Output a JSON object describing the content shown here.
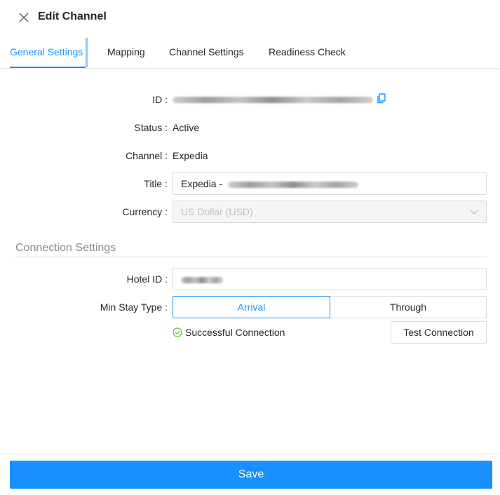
{
  "header": {
    "title": "Edit Channel",
    "close_icon": "close-icon"
  },
  "tabs": [
    {
      "label": "General Settings",
      "active": true
    },
    {
      "label": "Mapping",
      "active": false
    },
    {
      "label": "Channel Settings",
      "active": false
    },
    {
      "label": "Readiness Check",
      "active": false
    }
  ],
  "general": {
    "id_label": "ID",
    "copy_icon": "copy-icon",
    "status_label": "Status",
    "status_value": "Active",
    "channel_label": "Channel",
    "channel_value": "Expedia",
    "title_label": "Title",
    "title_value_prefix": "Expedia -",
    "currency_label": "Currency",
    "currency_value": "US Dollar (USD)"
  },
  "connection": {
    "section_title": "Connection Settings",
    "hotel_id_label": "Hotel ID",
    "min_stay_label": "Min Stay Type",
    "min_stay_options": [
      "Arrival",
      "Through"
    ],
    "min_stay_selected": "Arrival",
    "status_text": "Successful Connection",
    "test_button": "Test Connection"
  },
  "footer": {
    "save_label": "Save"
  },
  "colors": {
    "accent": "#1890ff",
    "success": "#52c41a"
  }
}
